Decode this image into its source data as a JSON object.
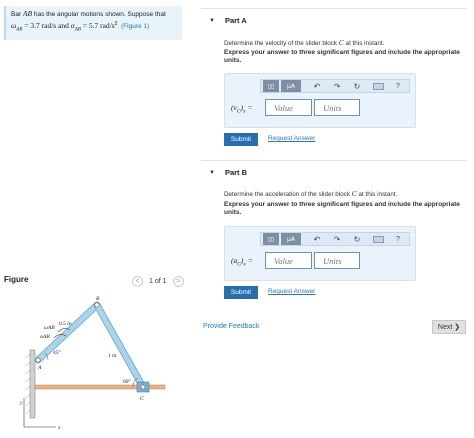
{
  "problem": {
    "text_intro": "Bar ",
    "bar_name": "AB",
    "text_mid": " has the angular motions shown. Suppose that",
    "omega_symbol": "ω",
    "omega_sub": "AB",
    "omega_value": " = 3.7  rad/s and ",
    "alpha_symbol": "α",
    "alpha_sub": "AB",
    "alpha_value": " = 5.7  rad/s",
    "alpha_exp": "2",
    "figure_link": ". (Figure 1)"
  },
  "figure": {
    "label": "Figure",
    "pager": "1 of 1",
    "prev": "<",
    "next": ">",
    "labels": {
      "B": "B",
      "C": "C",
      "A": "A",
      "len_ab": "0.5 m",
      "len_bc": "1 m",
      "omega": "ωAB",
      "alpha": "αAB",
      "angle_a": "45°",
      "angle_c": "60°",
      "y": "y",
      "x": "x"
    }
  },
  "partA": {
    "title": "Part A",
    "instruction_pre": "Determine the velocity of the slider block ",
    "instruction_var": "C",
    "instruction_post": " at this instant.",
    "bold": "Express your answer to three significant figures and include the appropriate units.",
    "var_main": "(v",
    "var_sub": "C",
    "var_tail": ")",
    "var_sub2": "x",
    "var_eq": " =",
    "value_placeholder": "Value",
    "units_placeholder": "Units",
    "submit": "Submit",
    "request": "Request Answer"
  },
  "partB": {
    "title": "Part B",
    "instruction_pre": "Determine the acceleration of the slider block ",
    "instruction_var": "C",
    "instruction_post": " at this instant.",
    "bold": "Express your answer to three significant figures and include the appropriate units.",
    "var_main": "(a",
    "var_sub": "C",
    "var_tail": ")",
    "var_sub2": "x",
    "var_eq": " =",
    "value_placeholder": "Value",
    "units_placeholder": "Units",
    "submit": "Submit",
    "request": "Request Answer"
  },
  "toolbar": {
    "templates_icon": "templates-icon",
    "units_label": "μA",
    "undo": "↶",
    "redo": "↷",
    "reset": "↻",
    "help": "?"
  },
  "footer": {
    "feedback": "Provide Feedback",
    "next": "Next ❯"
  },
  "colors": {
    "accent": "#2a6fad",
    "link": "#2a78b5",
    "problem_bg": "#e8f3fa",
    "answer_bg": "#eaf2fb",
    "bar_fill": "#a9d4ea"
  }
}
